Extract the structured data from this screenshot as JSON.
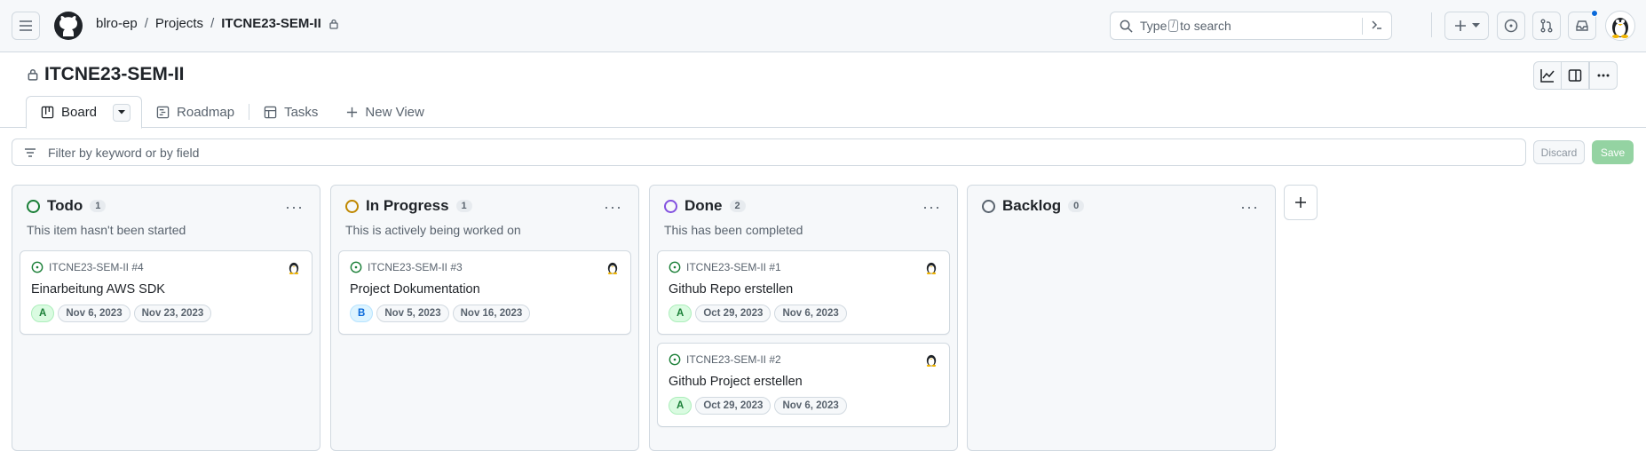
{
  "nav": {
    "owner": "blro-ep",
    "section": "Projects",
    "project": "ITCNE23-SEM-II",
    "search_placeholder_pre": "Type",
    "search_key": "/",
    "search_placeholder_post": "to search"
  },
  "project": {
    "title": "ITCNE23-SEM-II"
  },
  "tabs": [
    {
      "label": "Board",
      "icon": "board-icon",
      "active": true
    },
    {
      "label": "Roadmap",
      "icon": "roadmap-icon"
    },
    {
      "label": "Tasks",
      "icon": "table-icon"
    },
    {
      "label": "New View",
      "icon": "plus-icon"
    }
  ],
  "filter": {
    "placeholder": "Filter by keyword or by field",
    "discard": "Discard",
    "save": "Save"
  },
  "columns": [
    {
      "name": "Todo",
      "count": "1",
      "color": "#1a7f37",
      "description": "This item hasn't been started",
      "cards": [
        {
          "ref": "ITCNE23-SEM-II #4",
          "title": "Einarbeitung AWS SDK",
          "priority": "A",
          "start": "Nov 6, 2023",
          "end": "Nov 23, 2023"
        }
      ]
    },
    {
      "name": "In Progress",
      "count": "1",
      "color": "#bf8700",
      "description": "This is actively being worked on",
      "cards": [
        {
          "ref": "ITCNE23-SEM-II #3",
          "title": "Project Dokumentation",
          "priority": "B",
          "start": "Nov 5, 2023",
          "end": "Nov 16, 2023"
        }
      ]
    },
    {
      "name": "Done",
      "count": "2",
      "color": "#8250df",
      "description": "This has been completed",
      "cards": [
        {
          "ref": "ITCNE23-SEM-II #1",
          "title": "Github Repo erstellen",
          "priority": "A",
          "start": "Oct 29, 2023",
          "end": "Nov 6, 2023"
        },
        {
          "ref": "ITCNE23-SEM-II #2",
          "title": "Github Project erstellen",
          "priority": "A",
          "start": "Oct 29, 2023",
          "end": "Nov 6, 2023"
        }
      ]
    },
    {
      "name": "Backlog",
      "count": "0",
      "color": "#59636e",
      "description": "",
      "cards": []
    }
  ]
}
